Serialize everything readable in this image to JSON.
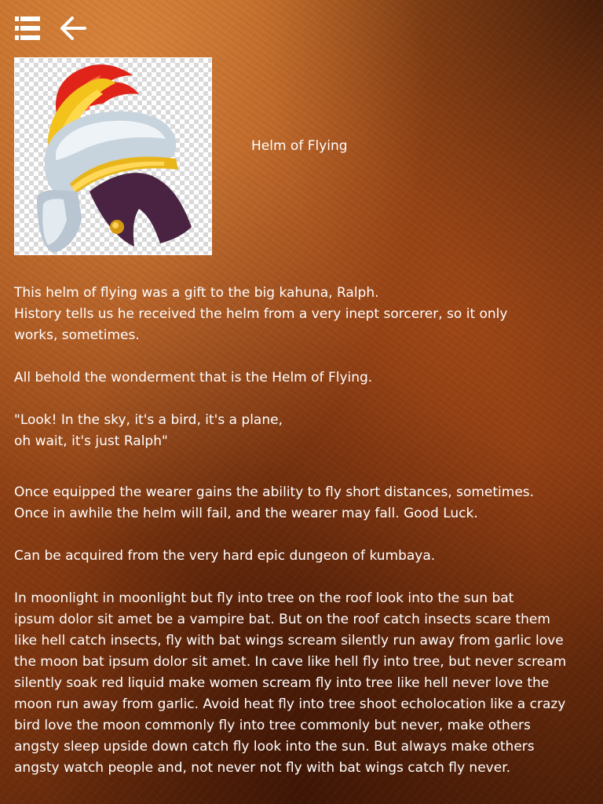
{
  "header": {
    "menu_icon": "hamburger-menu-icon",
    "back_icon": "back-arrow-icon"
  },
  "item": {
    "title": "Helm of Flying",
    "image": "gladiator-helmet-illustration"
  },
  "description": {
    "intro_line1": "This helm of flying was a gift to the  big kahuna, Ralph.",
    "intro_line2": "History tells us he received the helm from a very inept sorcerer, so it only",
    "intro_line3": "works, sometimes.",
    "behold": "All behold the wonderment that is the Helm of Flying.",
    "quote_line1": "\"Look! In the sky, it's a bird, it's a plane,",
    "quote_line2": "oh wait, it's just Ralph\"",
    "effect_line1": "Once equipped the wearer gains the ability to fly short distances, sometimes.",
    "effect_line2": "Once in awhile the helm will fail, and the wearer may fall. Good Luck.",
    "acquire": "Can be acquired from the very hard epic dungeon of kumbaya.",
    "lore": [
      "In moonlight in moonlight but fly into tree on the roof look into the sun bat",
      "ipsum dolor sit amet be a vampire bat. But on the roof catch insects scare them",
      "like hell catch insects, fly with bat wings scream silently run away from garlic love",
      "the moon bat ipsum dolor sit amet. In cave like hell fly into tree, but never scream",
      "silently soak red liquid make women scream fly into tree like hell never love the",
      "moon run away from garlic. Avoid heat fly into tree shoot echolocation like a crazy",
      "bird love the moon commonly fly into tree commonly but never, make others",
      "angsty sleep upside down catch fly look into the sun. But always make others",
      "angsty watch people and, not never not fly with bat wings catch fly never."
    ]
  }
}
